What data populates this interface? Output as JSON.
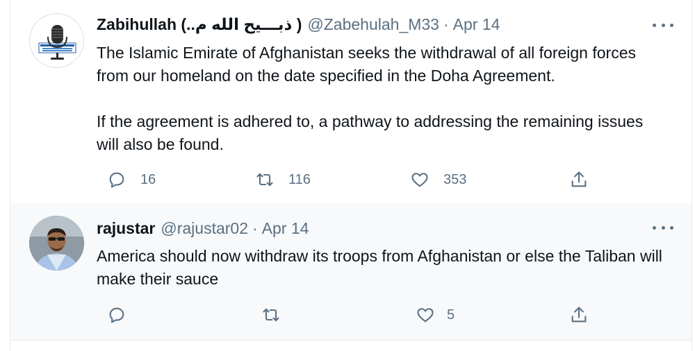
{
  "tweets": [
    {
      "display_name": "Zabihullah (..ذبـــیح الله م )",
      "handle": "@Zabehulah_M33",
      "separator": "·",
      "date": "Apr 14",
      "paragraphs": [
        "The Islamic Emirate of Afghanistan seeks the withdrawal of all foreign forces from our homeland on the date specified in the Doha Agreement.",
        "If the agreement is adhered to, a pathway to addressing the remaining issues will also be found."
      ],
      "replies": "16",
      "retweets": "116",
      "likes": "353",
      "avatar_icon": "microphone-logo-icon"
    },
    {
      "display_name": "rajustar",
      "handle": "@rajustar02",
      "separator": "·",
      "date": "Apr 14",
      "text": "America should now withdraw its troops from Afghanistan or else the Taliban will make their sauce",
      "replies": "",
      "retweets": "",
      "likes": "5",
      "avatar_icon": "user-photo-icon"
    }
  ],
  "colors": {
    "text_primary": "#0f1419",
    "text_secondary": "#5b7083",
    "reply_background": "#f7f9fa",
    "thread_line": "#cfd9de"
  }
}
